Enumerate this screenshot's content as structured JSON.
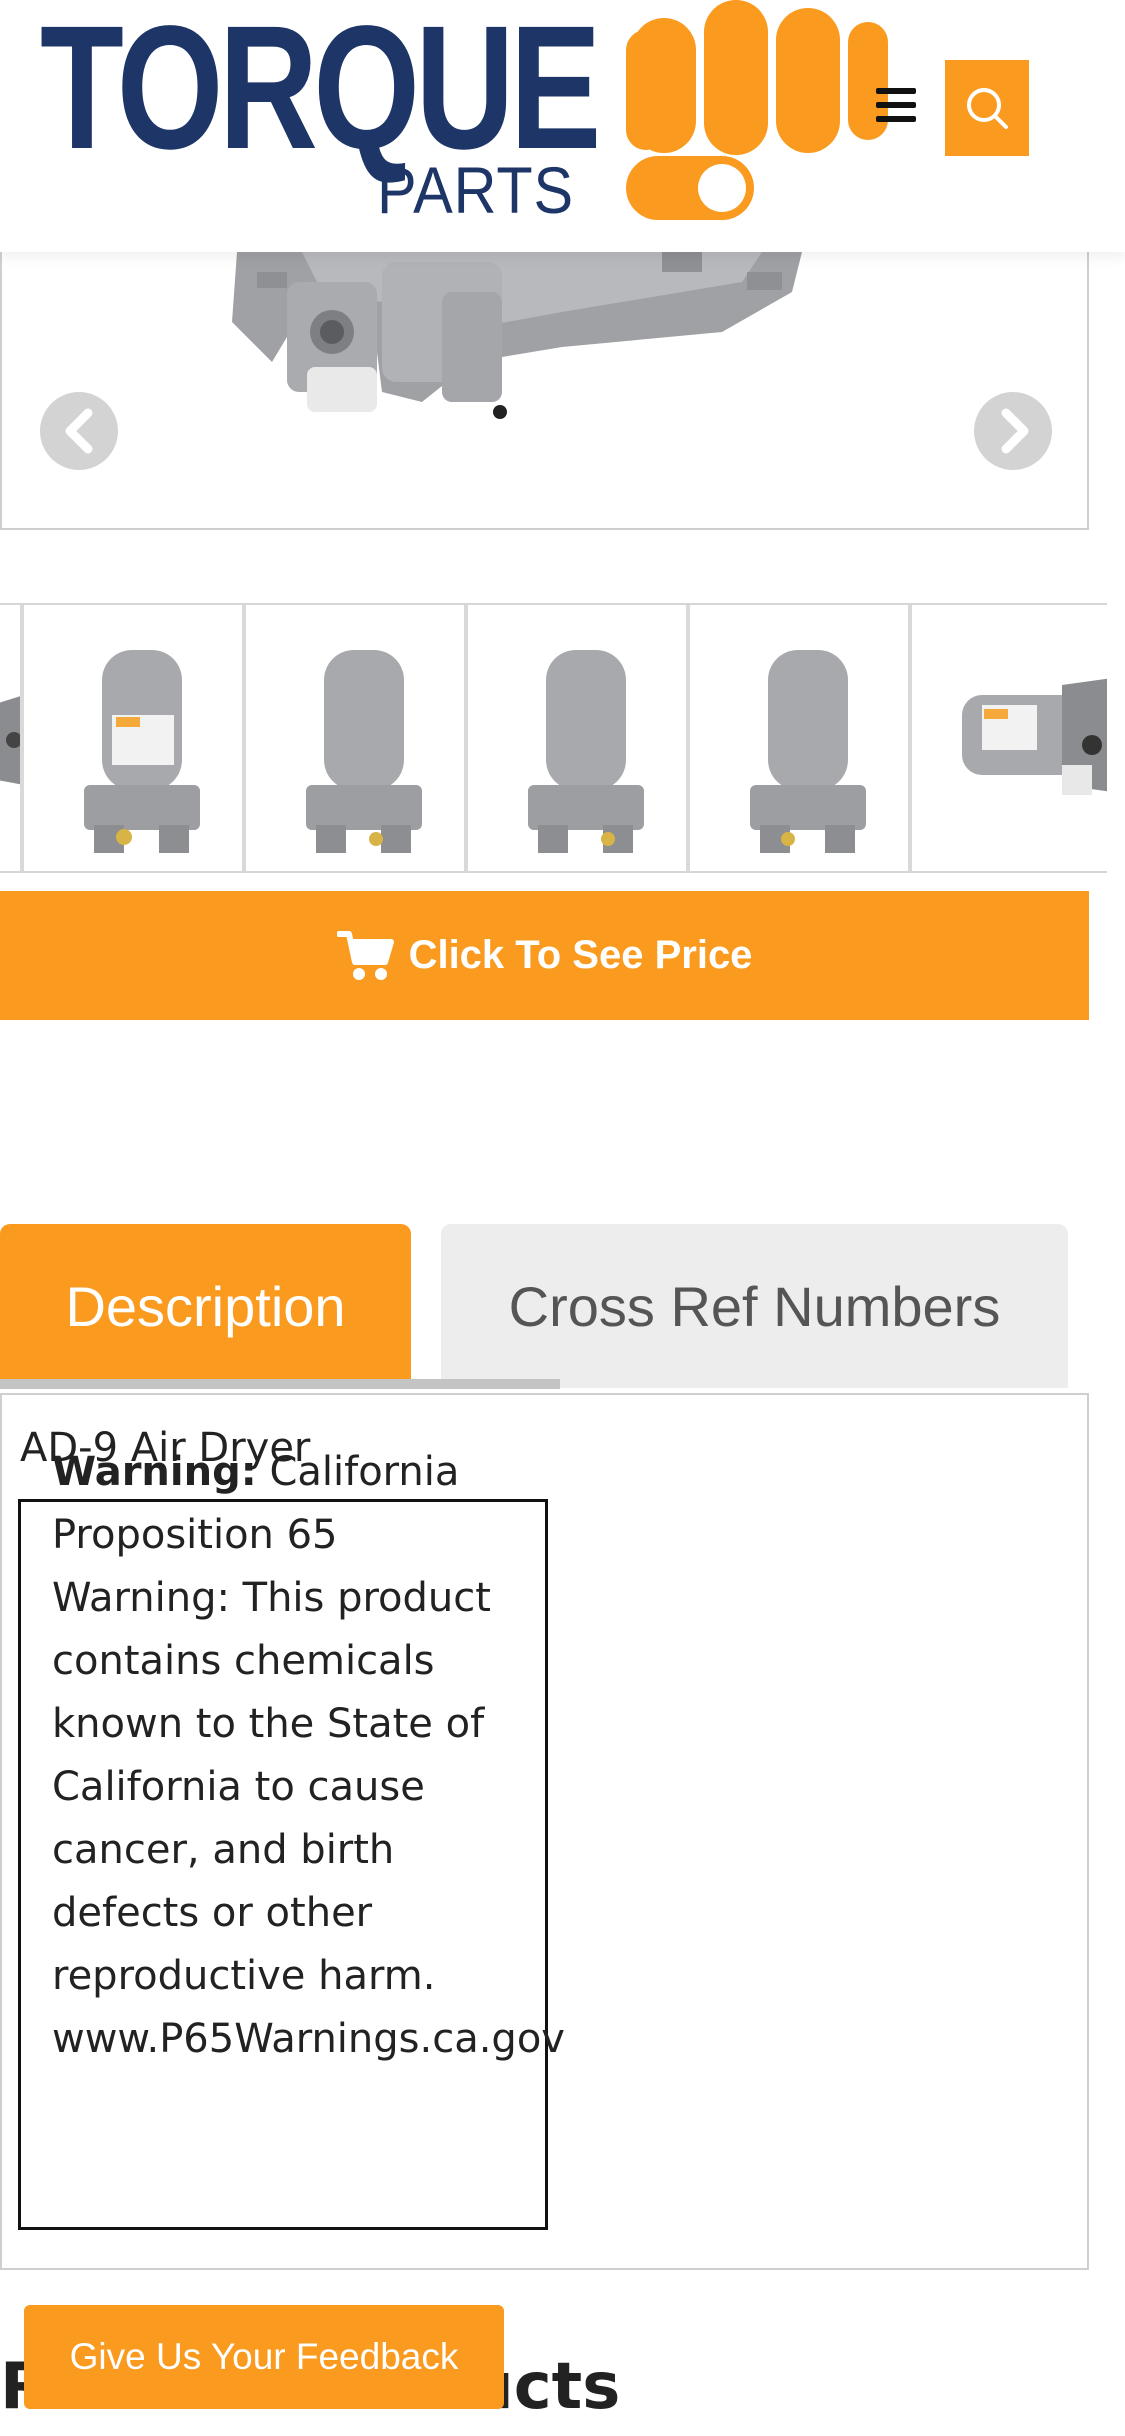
{
  "brand": {
    "logo_word": "TORQUE",
    "logo_sub": "PARTS",
    "accent_color": "#fa9a1e",
    "navy_color": "#1e3567"
  },
  "header": {
    "menu_icon": "hamburger-menu-icon",
    "search_icon": "search-icon"
  },
  "gallery": {
    "prev_icon": "chevron-left-icon",
    "next_icon": "chevron-right-icon",
    "thumbnails": 7
  },
  "cta": {
    "price_label": "Click To See Price",
    "cart_icon": "shopping-cart-icon"
  },
  "tabs": [
    {
      "label": "Description",
      "active": true
    },
    {
      "label": "Cross Ref Numbers",
      "active": false
    }
  ],
  "description": {
    "product_name": "AD-9 Air Dryer",
    "warning_label": "Warning:",
    "warning_lines": [
      "California",
      "Proposition 65",
      "Warning: This product",
      "contains chemicals",
      "known to the State of",
      "California to cause",
      "cancer, and birth",
      "defects or other",
      "reproductive harm.",
      "www.P65Warnings.ca.gov"
    ]
  },
  "related": {
    "heading": "Related Products"
  },
  "feedback": {
    "label": "Give Us Your Feedback"
  }
}
